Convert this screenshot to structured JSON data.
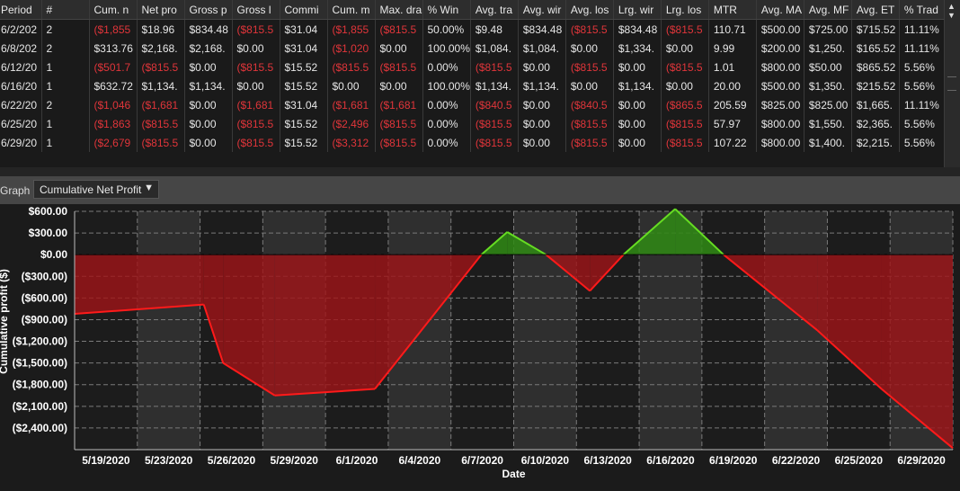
{
  "table": {
    "columns": [
      "Period",
      "#",
      "Cum. n",
      "Net pro",
      "Gross p",
      "Gross l",
      "Commi",
      "Cum. m",
      "Max. dra",
      "% Win",
      "Avg. tra",
      "Avg. wir",
      "Avg. los",
      "Lrg. wir",
      "Lrg. los",
      "MTR",
      "Avg. MA",
      "Avg. MF",
      "Avg. ET",
      "% Trad"
    ],
    "rows": [
      [
        "6/2/202",
        "2",
        "($1,855",
        "$18.96",
        "$834.48",
        "($815.5",
        "$31.04",
        "($1,855",
        "($815.5",
        "50.00%",
        "$9.48",
        "$834.48",
        "($815.5",
        "$834.48",
        "($815.5",
        "110.71",
        "$500.00",
        "$725.00",
        "$715.52",
        "11.11%"
      ],
      [
        "6/8/202",
        "2",
        "$313.76",
        "$2,168.",
        "$2,168.",
        "$0.00",
        "$31.04",
        "($1,020",
        "$0.00",
        "100.00%",
        "$1,084.",
        "$1,084.",
        "$0.00",
        "$1,334.",
        "$0.00",
        "9.99",
        "$200.00",
        "$1,250.",
        "$165.52",
        "11.11%"
      ],
      [
        "6/12/20",
        "1",
        "($501.7",
        "($815.5",
        "$0.00",
        "($815.5",
        "$15.52",
        "($815.5",
        "($815.5",
        "0.00%",
        "($815.5",
        "$0.00",
        "($815.5",
        "$0.00",
        "($815.5",
        "1.01",
        "$800.00",
        "$50.00",
        "$865.52",
        "5.56%"
      ],
      [
        "6/16/20",
        "1",
        "$632.72",
        "$1,134.",
        "$1,134.",
        "$0.00",
        "$15.52",
        "$0.00",
        "$0.00",
        "100.00%",
        "$1,134.",
        "$1,134.",
        "$0.00",
        "$1,134.",
        "$0.00",
        "20.00",
        "$500.00",
        "$1,350.",
        "$215.52",
        "5.56%"
      ],
      [
        "6/22/20",
        "2",
        "($1,046",
        "($1,681",
        "$0.00",
        "($1,681",
        "$31.04",
        "($1,681",
        "($1,681",
        "0.00%",
        "($840.5",
        "$0.00",
        "($840.5",
        "$0.00",
        "($865.5",
        "205.59",
        "$825.00",
        "$825.00",
        "$1,665.",
        "11.11%"
      ],
      [
        "6/25/20",
        "1",
        "($1,863",
        "($815.5",
        "$0.00",
        "($815.5",
        "$15.52",
        "($2,496",
        "($815.5",
        "0.00%",
        "($815.5",
        "$0.00",
        "($815.5",
        "$0.00",
        "($815.5",
        "57.97",
        "$800.00",
        "$1,550.",
        "$2,365.",
        "5.56%"
      ],
      [
        "6/29/20",
        "1",
        "($2,679",
        "($815.5",
        "$0.00",
        "($815.5",
        "$15.52",
        "($3,312",
        "($815.5",
        "0.00%",
        "($815.5",
        "$0.00",
        "($815.5",
        "$0.00",
        "($815.5",
        "107.22",
        "$800.00",
        "$1,400.",
        "$2,215.",
        "5.56%"
      ]
    ]
  },
  "graph": {
    "label": "Graph",
    "selected": "Cumulative Net Profit"
  },
  "chart_data": {
    "type": "area",
    "xlabel": "Date",
    "ylabel": "Cumulative profit ($)",
    "x_ticks": [
      "5/19/2020",
      "5/23/2020",
      "5/26/2020",
      "5/29/2020",
      "6/1/2020",
      "6/4/2020",
      "6/7/2020",
      "6/10/2020",
      "6/13/2020",
      "6/16/2020",
      "6/19/2020",
      "6/22/2020",
      "6/25/2020",
      "6/29/2020"
    ],
    "y_ticks": [
      "$600.00",
      "$300.00",
      "$0.00",
      "($300.00)",
      "($600.00)",
      "($900.00)",
      "($1,200.00)",
      "($1,500.00)",
      "($1,800.00)",
      "($2,100.00)",
      "($2,400.00)"
    ],
    "y_tick_values": [
      600,
      300,
      0,
      -300,
      -600,
      -900,
      -1200,
      -1500,
      -1800,
      -2100,
      -2400
    ],
    "ylim": [
      -2700,
      600
    ],
    "x_index_range": [
      0,
      13.6
    ],
    "points": [
      {
        "x": 0.0,
        "y": -820
      },
      {
        "x": 2.0,
        "y": -690
      },
      {
        "x": 2.3,
        "y": -1500
      },
      {
        "x": 3.1,
        "y": -1950
      },
      {
        "x": 4.65,
        "y": -1860
      },
      {
        "x": 6.3,
        "y": 0
      },
      {
        "x": 6.7,
        "y": 313.76
      },
      {
        "x": 7.3,
        "y": 0
      },
      {
        "x": 7.98,
        "y": -501.72
      },
      {
        "x": 8.5,
        "y": 0
      },
      {
        "x": 9.3,
        "y": 632.72
      },
      {
        "x": 10.05,
        "y": 0
      },
      {
        "x": 11.5,
        "y": -1046
      },
      {
        "x": 12.5,
        "y": -1863
      },
      {
        "x": 13.6,
        "y": -2679
      }
    ],
    "colors": {
      "positive": "#2f8a14",
      "positive_line": "#66dd22",
      "negative": "#a01418",
      "negative_line": "#ff1a1a"
    },
    "grid": true
  }
}
